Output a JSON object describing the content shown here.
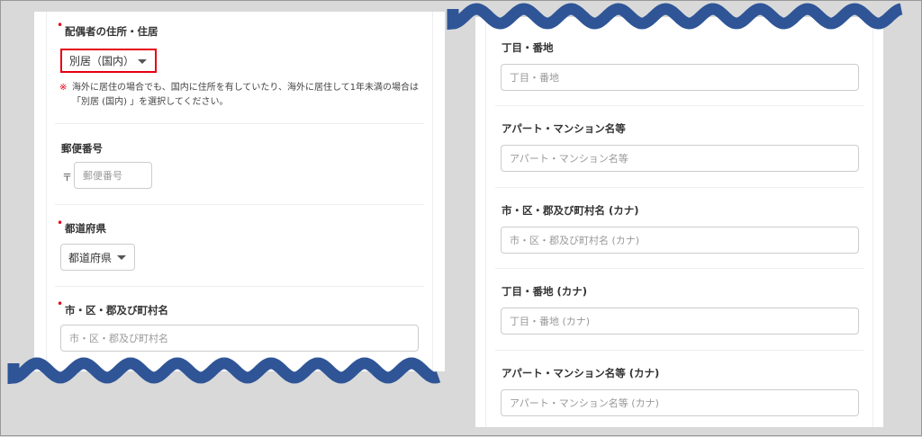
{
  "left": {
    "spouse_address": {
      "label": "配偶者の住所・住居",
      "value": "別居（国内）",
      "note_mark": "※",
      "note": "海外に居住の場合でも、国内に住所を有していたり、海外に居住して1年未満の場合は「別居 (国内) 」を選択してください。"
    },
    "postal": {
      "label": "郵便番号",
      "symbol": "〒",
      "placeholder": "郵便番号"
    },
    "prefecture": {
      "label": "都道府県",
      "value": "都道府県"
    },
    "city": {
      "label": "市・区・郡及び町村名",
      "placeholder": "市・区・郡及び町村名"
    }
  },
  "right": {
    "fields": [
      {
        "label": "丁目・番地",
        "placeholder": "丁目・番地"
      },
      {
        "label": "アパート・マンション名等",
        "placeholder": "アパート・マンション名等"
      },
      {
        "label": "市・区・郡及び町村名 (カナ)",
        "placeholder": "市・区・郡及び町村名 (カナ)"
      },
      {
        "label": "丁目・番地 (カナ)",
        "placeholder": "丁目・番地 (カナ)"
      },
      {
        "label": "アパート・マンション名等 (カナ)",
        "placeholder": "アパート・マンション名等 (カナ)"
      }
    ]
  },
  "colors": {
    "wave": "#2f5597",
    "highlight": "#e60012",
    "required": "#e60012"
  }
}
